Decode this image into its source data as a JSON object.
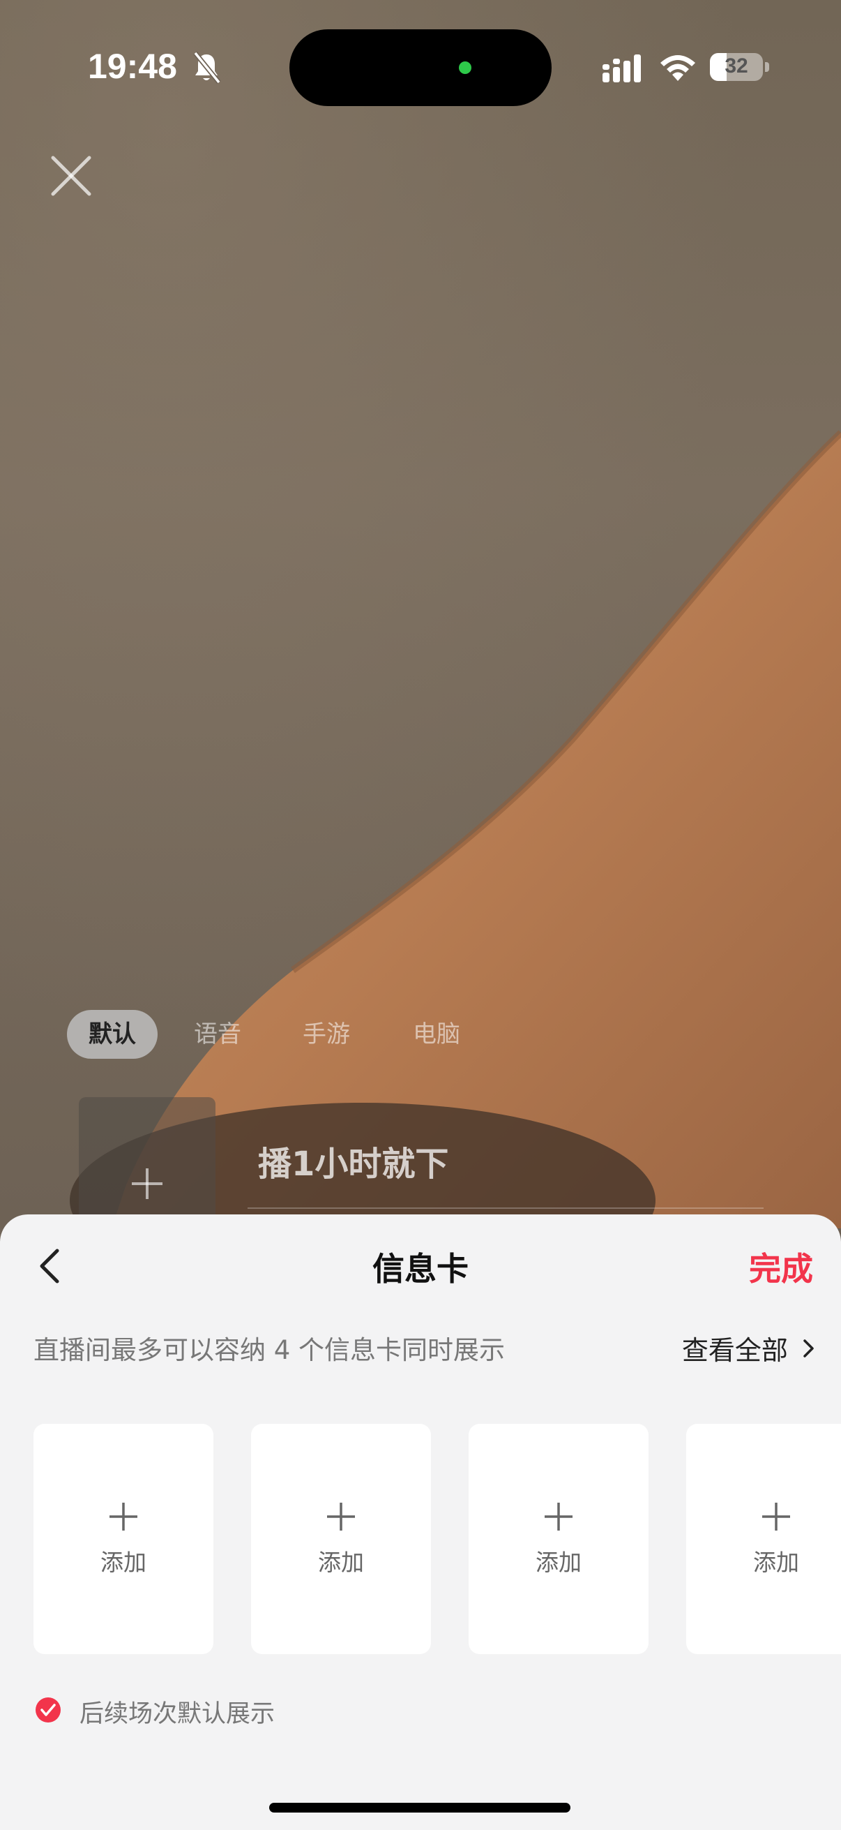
{
  "status_bar": {
    "time": "19:48",
    "battery_level": "32",
    "battery_fraction": 0.32
  },
  "camera": {
    "close_icon": "close-icon",
    "mode_tabs": [
      {
        "label": "默认",
        "active": true
      },
      {
        "label": "语音",
        "active": false
      },
      {
        "label": "手游",
        "active": false
      },
      {
        "label": "电脑",
        "active": false
      }
    ],
    "live_title": "播1小时就下"
  },
  "sheet": {
    "title": "信息卡",
    "done_label": "完成",
    "done_color": "#f2344b",
    "limit_text": "直播间最多可以容纳 4 个信息卡同时展示",
    "view_all_label": "查看全部",
    "cards": [
      {
        "label": "添加"
      },
      {
        "label": "添加"
      },
      {
        "label": "添加"
      },
      {
        "label": "添加"
      }
    ],
    "default_show_label": "后续场次默认展示",
    "default_show_checked": true
  }
}
